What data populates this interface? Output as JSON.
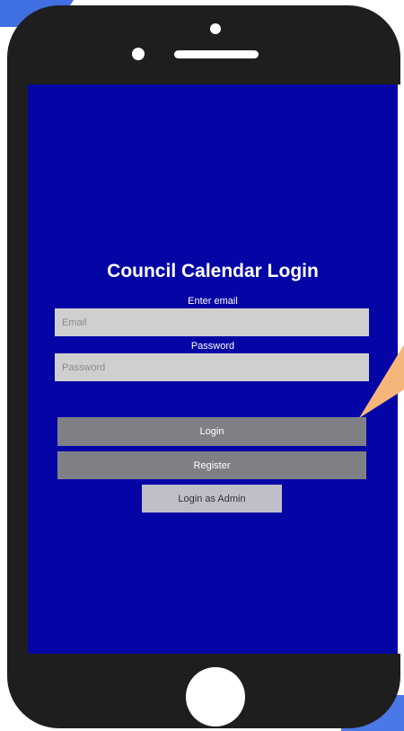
{
  "login_screen": {
    "title": "Council Calendar Login",
    "email": {
      "label": "Enter email",
      "placeholder": "Email",
      "value": ""
    },
    "password": {
      "label": "Password",
      "placeholder": "Password",
      "value": ""
    },
    "buttons": {
      "login": "Login",
      "register": "Register",
      "admin": "Login as Admin"
    }
  },
  "colors": {
    "screen_background": "#0505a6",
    "phone_frame": "#1e1e1e",
    "input_background": "#cfcfcf",
    "primary_button": "#7f7f86",
    "secondary_button": "#bfbfc9",
    "callout": "#f5b67a",
    "page_accent": "#4a78e6"
  }
}
